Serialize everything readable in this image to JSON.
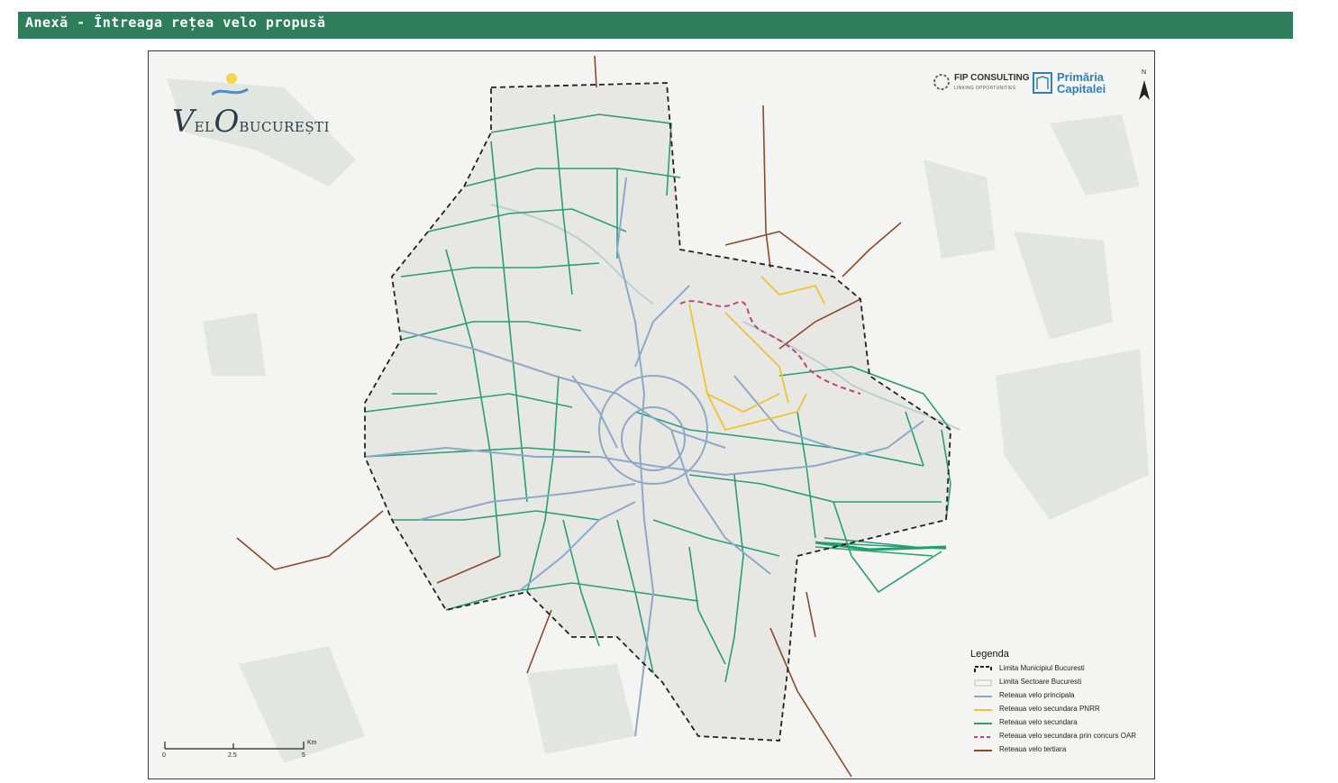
{
  "header": {
    "title": "Anexă - Întreaga rețea velo propusă",
    "color": "#2e7d5b"
  },
  "logos": {
    "velo_big_v": "V",
    "velo_small_el": "EL",
    "velo_big_o": "O",
    "velo_small_city": "BUCUREȘTI",
    "fip_name": "FIP CONSULTING",
    "fip_tagline": "LINKING OPPORTUNITIES",
    "pmb_line1": "Primăria",
    "pmb_line2": "Capitalei"
  },
  "north_label": "N",
  "legend": {
    "title": "Legenda",
    "items": [
      {
        "label": "Limita Municipiul Bucuresti",
        "style": "dashed-black",
        "color": "#222222"
      },
      {
        "label": "Limita Sectoare Bucuresti",
        "style": "box-grey",
        "color": "#bdbdbd"
      },
      {
        "label": "Reteaua velo principala",
        "style": "line",
        "color": "#8ea9c7"
      },
      {
        "label": "Reteaua velo secundara PNRR",
        "style": "line",
        "color": "#f2c12e"
      },
      {
        "label": "Reteaua velo secundara",
        "style": "line",
        "color": "#2a9d78"
      },
      {
        "label": "Reteaua velo secundara prin concurs OAR",
        "style": "dashed",
        "color": "#c2437a"
      },
      {
        "label": "Reteaua velo tertiara",
        "style": "line",
        "color": "#8b4a2b"
      }
    ]
  },
  "scale": {
    "ticks": [
      "0",
      "2.5",
      "5"
    ],
    "unit": "Km"
  }
}
